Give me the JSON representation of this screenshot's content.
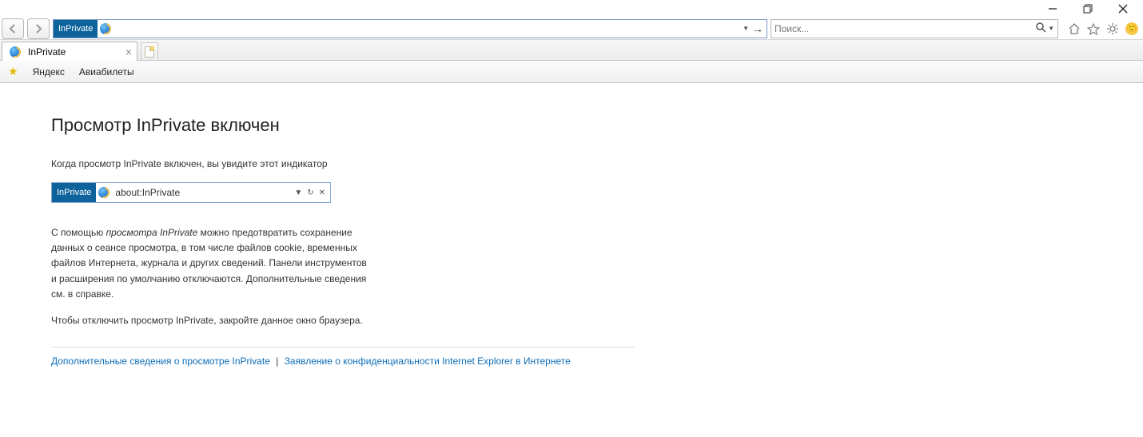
{
  "window": {
    "minimize_tooltip": "Minimize",
    "maximize_tooltip": "Restore",
    "close_tooltip": "Close"
  },
  "toolbar": {
    "inprivate_badge": "InPrivate",
    "address_value": "",
    "search_placeholder": "Поиск..."
  },
  "tabs": {
    "active": {
      "title": "InPrivate"
    }
  },
  "favorites": {
    "items": [
      "Яндекс",
      "Авиабилеты"
    ]
  },
  "content": {
    "heading": "Просмотр InPrivate включен",
    "lead": "Когда просмотр InPrivate включен, вы увидите этот индикатор",
    "mini_badge": "InPrivate",
    "mini_url": "about:InPrivate",
    "body_prefix": "С помощью ",
    "body_em": "просмотра InPrivate",
    "body_rest": " можно предотвратить сохранение данных о сеансе просмотра, в том числе файлов cookie, временных файлов Интернета, журнала и других сведений. Панели инструментов и расширения по умолчанию отключаются. Дополнительные сведения см. в справке.",
    "turnoff": "Чтобы отключить просмотр InPrivate, закройте данное окно браузера.",
    "link1": "Дополнительные сведения о просмотре InPrivate",
    "link2": "Заявление о конфиденциальности Internet Explorer в Интернете"
  }
}
